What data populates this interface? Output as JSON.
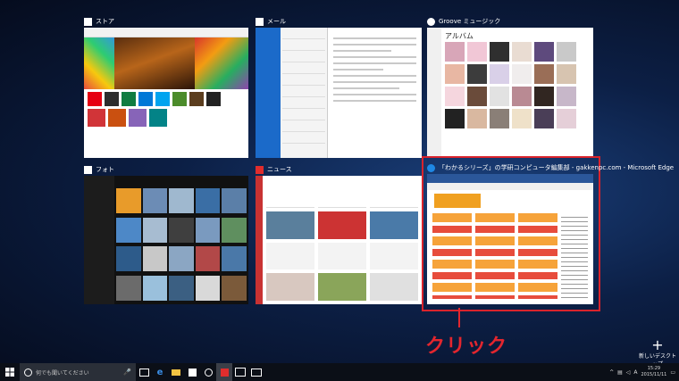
{
  "windows": {
    "store": {
      "title": "ストア"
    },
    "mail": {
      "title": "メール"
    },
    "groove": {
      "title": "Groove ミュージック",
      "heading": "アルバム"
    },
    "photos": {
      "title": "フォト"
    },
    "news": {
      "title": "ニュース"
    },
    "edge": {
      "title": "「わかるシリーズ」の学研コンピュータ編集部 - gakkenpc.com - Microsoft Edge"
    }
  },
  "annotation": {
    "label": "クリック",
    "color": "#e3262e"
  },
  "new_desktop": {
    "label": "新しいデスクトップ"
  },
  "taskbar": {
    "search_placeholder": "何でも聞いてください",
    "ime": "A",
    "time": "15:29",
    "date": "2015/11/11"
  },
  "colors": {
    "highlight": "#d9232c",
    "accent": "#1b6ac9"
  }
}
